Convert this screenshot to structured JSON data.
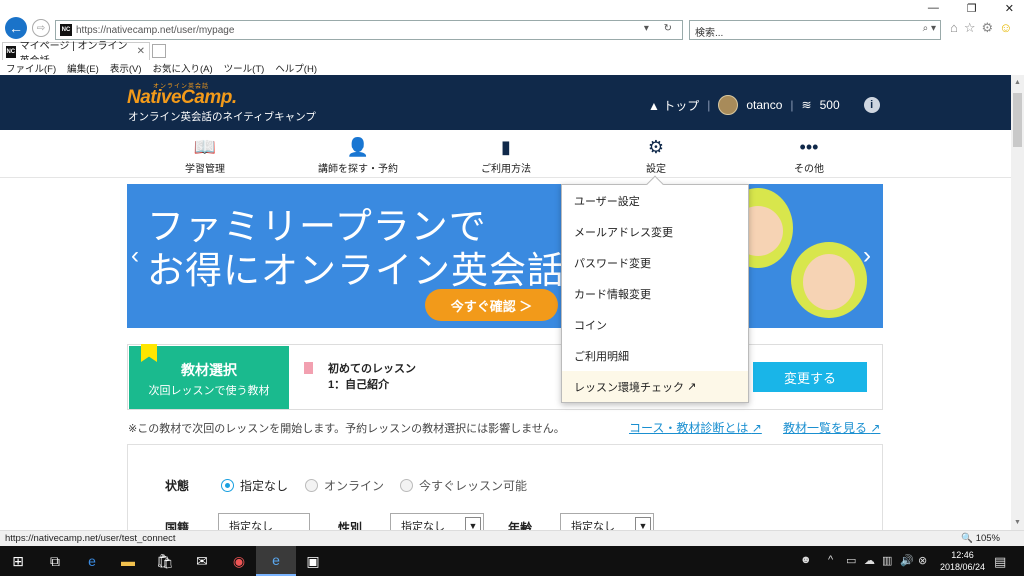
{
  "browser": {
    "url": "https://nativecamp.net/user/mypage",
    "search_placeholder": "検索...",
    "tab_title": "マイページ | オンライン英会話...",
    "favicon_text": "NC",
    "menu": [
      "ファイル(F)",
      "編集(E)",
      "表示(V)",
      "お気に入り(A)",
      "ツール(T)",
      "ヘルプ(H)"
    ],
    "status_url": "https://nativecamp.net/user/test_connect",
    "zoom": "105%"
  },
  "header": {
    "logo_small": "オンライン英会話",
    "logo": "NativeCamp.",
    "tagline": "オンライン英会話のネイティブキャンプ",
    "top_label": "トップ",
    "username": "otanco",
    "coins": "500"
  },
  "nav": {
    "items": [
      {
        "label": "学習管理",
        "icon": "book-icon"
      },
      {
        "label": "講師を探す・予約",
        "icon": "teacher-icon"
      },
      {
        "label": "ご利用方法",
        "icon": "guide-icon"
      },
      {
        "label": "設定",
        "icon": "gear-icon"
      },
      {
        "label": "その他",
        "icon": "more-icon"
      }
    ]
  },
  "banner": {
    "line1": "ファミリープランで",
    "line2": "お得にオンライン英会話",
    "button": "今すぐ確認 ＞"
  },
  "dropdown": {
    "items": [
      "ユーザー設定",
      "メールアドレス変更",
      "パスワード変更",
      "カード情報変更",
      "コイン",
      "ご利用明細",
      "レッスン環境チェック"
    ]
  },
  "material": {
    "title": "教材選択",
    "subtitle": "次回レッスンで使う教材",
    "lesson_name": "初めてのレッスン",
    "lesson_chapter": "1：自己紹介",
    "change_button": "変更する"
  },
  "note": "※この教材で次回のレッスンを開始します。予約レッスンの教材選択には影響しません。",
  "links": {
    "course": "コース・教材診断とは",
    "list": "教材一覧を見る"
  },
  "search": {
    "status_label": "状態",
    "options": [
      "指定なし",
      "オンライン",
      "今すぐレッスン可能"
    ],
    "selected": 0,
    "country_label": "国籍",
    "gender_label": "性別",
    "age_label": "年齢",
    "select_default": "指定なし"
  },
  "taskbar": {
    "time": "12:46",
    "date": "2018/06/24"
  }
}
